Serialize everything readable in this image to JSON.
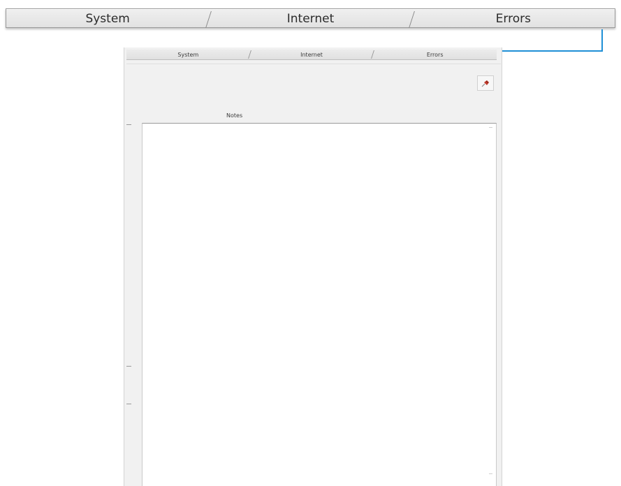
{
  "zoomed_tabs": [
    "System",
    "Internet",
    "Errors"
  ],
  "window": {
    "tabs": [
      "System",
      "Internet",
      "Errors"
    ],
    "notes_label": "Notes",
    "notes_value": "",
    "tool_icon": "pin-icon"
  },
  "colors": {
    "callout_accent": "#1f8fd6",
    "tool_icon": "#c0392b"
  }
}
